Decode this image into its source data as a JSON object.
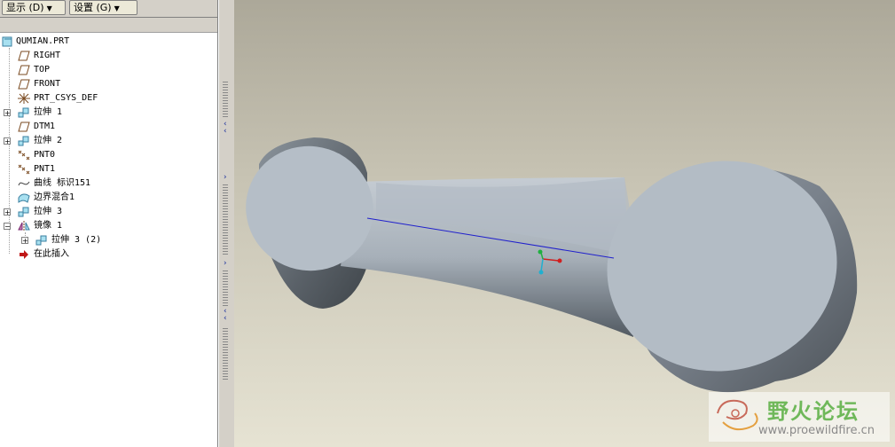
{
  "toolbar": {
    "display_button": "显示 (D)",
    "settings_button": "设置 (G)"
  },
  "model_tree": {
    "items": [
      {
        "label": "QUMIAN.PRT",
        "icon": "part-icon",
        "expander": ""
      },
      {
        "label": "RIGHT",
        "icon": "datum-plane-icon",
        "expander": ""
      },
      {
        "label": "TOP",
        "icon": "datum-plane-icon",
        "expander": ""
      },
      {
        "label": "FRONT",
        "icon": "datum-plane-icon",
        "expander": ""
      },
      {
        "label": "PRT_CSYS_DEF",
        "icon": "csys-icon",
        "expander": ""
      },
      {
        "label": "拉伸 1",
        "icon": "extrude-icon",
        "expander": "+"
      },
      {
        "label": "DTM1",
        "icon": "datum-plane-icon",
        "expander": ""
      },
      {
        "label": "拉伸 2",
        "icon": "extrude-icon",
        "expander": "+"
      },
      {
        "label": "PNT0",
        "icon": "datum-point-icon",
        "expander": ""
      },
      {
        "label": "PNT1",
        "icon": "datum-point-icon",
        "expander": ""
      },
      {
        "label": "曲线 标识151",
        "icon": "curve-icon",
        "expander": ""
      },
      {
        "label": "边界混合1",
        "icon": "boundary-blend-icon",
        "expander": ""
      },
      {
        "label": "拉伸 3",
        "icon": "extrude-icon",
        "expander": "+"
      },
      {
        "label": "镜像 1",
        "icon": "mirror-icon",
        "expander": "−"
      },
      {
        "label": "拉伸 3 (2)",
        "icon": "extrude-icon",
        "expander": "+"
      },
      {
        "label": "在此插入",
        "icon": "insert-here-arrow-icon",
        "expander": ""
      }
    ]
  },
  "watermark": {
    "title": "野火论坛",
    "url": "www.proewildfire.cn"
  },
  "colors": {
    "model": "#b3bcc5",
    "panel": "#ffffff",
    "chrome": "#d4d0c8"
  }
}
